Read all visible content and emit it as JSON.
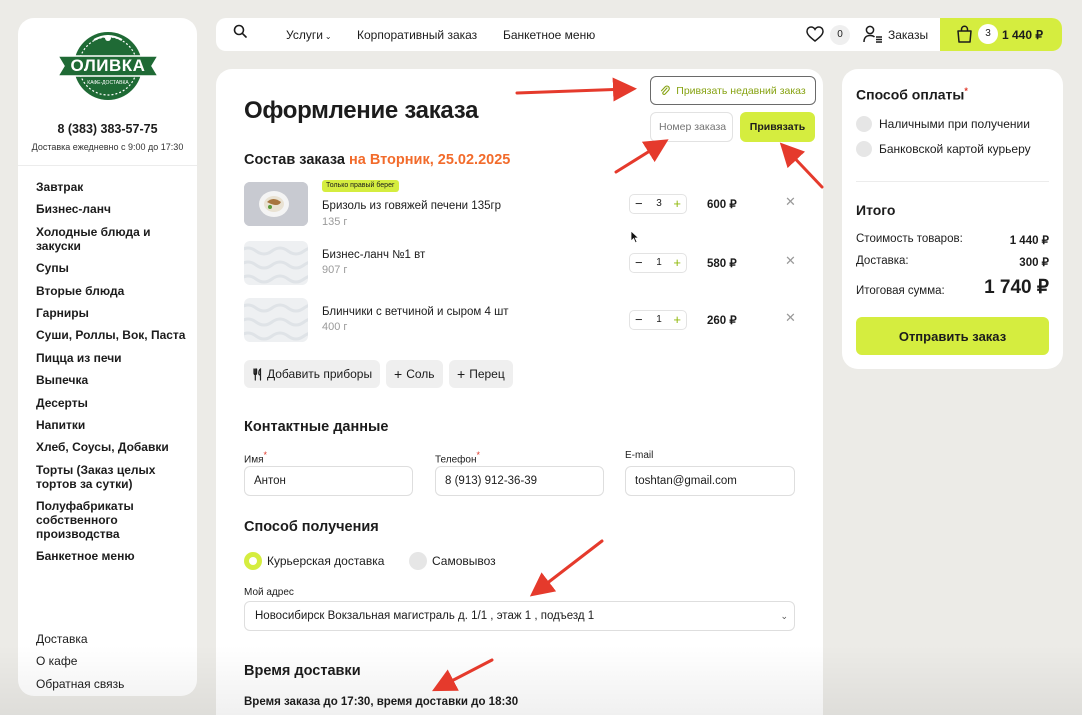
{
  "sidebar": {
    "logo_text": "ОЛИВКА",
    "logo_subtext": "КАФЕ-ДОСТАВКА",
    "phone": "8 (383) 383-57-75",
    "hours": "Доставка ежедневно с 9:00 до 17:30",
    "menu": [
      "Завтрак",
      "Бизнес-ланч",
      "Холодные блюда и закуски",
      "Супы",
      "Вторые блюда",
      "Гарниры",
      "Суши, Роллы, Вок, Паста",
      "Пицца из печи",
      "Выпечка",
      "Десерты",
      "Напитки",
      "Хлеб, Соусы, Добавки",
      "Торты (Заказ целых тортов за сутки)",
      "Полуфабрикаты собственного производства",
      "Банкетное меню"
    ],
    "footer": [
      "Доставка",
      "О кафе",
      "Обратная связь"
    ]
  },
  "topbar": {
    "nav": [
      "Услуги",
      "Корпоративный заказ",
      "Банкетное меню"
    ],
    "favorites_count": "0",
    "orders_label": "Заказы",
    "cart_count": "3",
    "cart_total": "1 440 ₽"
  },
  "main": {
    "title": "Оформление заказа",
    "attach_recent_label": "Привязать недавний заказ",
    "order_number_placeholder": "Номер заказа",
    "attach_button": "Привязать",
    "composition_label": "Состав заказа",
    "composition_date": "на Вторник, 25.02.2025",
    "items": [
      {
        "tag": "Только правый берег",
        "name": "Бризоль из говяжей печени 135гр",
        "weight": "135 г",
        "qty": "3",
        "price": "600 ₽"
      },
      {
        "tag": "",
        "name": "Бизнес-ланч №1 вт",
        "weight": "907 г",
        "qty": "1",
        "price": "580 ₽"
      },
      {
        "tag": "",
        "name": "Блинчики с ветчиной и сыром 4 шт",
        "weight": "400 г",
        "qty": "1",
        "price": "260 ₽"
      }
    ],
    "extras": [
      "Добавить приборы",
      "Соль",
      "Перец"
    ],
    "contacts_title": "Контактные данные",
    "name_label": "Имя",
    "name_value": "Антон",
    "phone_label": "Телефон",
    "phone_value": "8 (913) 912-36-39",
    "email_label": "E-mail",
    "email_value": "toshtan@gmail.com",
    "receive_title": "Способ получения",
    "courier_label": "Курьерская доставка",
    "pickup_label": "Самовывоз",
    "address_label": "Мой адрес",
    "address_value": "Новосибирск Вокзальная магистраль д. 1/1 , этаж 1 , подъезд 1",
    "delivery_time_title": "Время доставки",
    "delivery_note": "Время заказа до 17:30, время доставки до 18:30"
  },
  "payment": {
    "title": "Способ оплаты",
    "options": [
      "Наличными при получении",
      "Банковской картой курьеру"
    ],
    "total_title": "Итого",
    "goods_label": "Стоимость товаров:",
    "goods_value": "1 440 ₽",
    "delivery_label": "Доставка:",
    "delivery_value": "300 ₽",
    "final_label": "Итоговая сумма:",
    "final_value": "1 740 ₽",
    "submit": "Отправить заказ"
  },
  "colors": {
    "accent": "#d5ed3f",
    "brand_green": "#1f6a35",
    "date_orange": "#f26b2b",
    "annotation_red": "#e53a2c"
  }
}
